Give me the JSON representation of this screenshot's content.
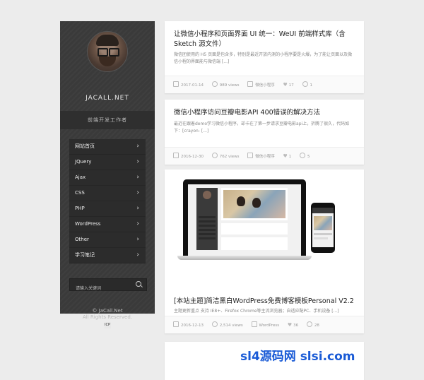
{
  "sidebar": {
    "site_name": "JACALL.NET",
    "tagline": "前端开发工作者",
    "nav": [
      {
        "label": "网站首页"
      },
      {
        "label": "JQuery"
      },
      {
        "label": "Ajax"
      },
      {
        "label": "CSS"
      },
      {
        "label": "PHP"
      },
      {
        "label": "WordPress"
      },
      {
        "label": "Other"
      },
      {
        "label": "学习笔记"
      }
    ],
    "search_placeholder": "请输入关键词",
    "footer_line1": "© JaCall.Net",
    "footer_line2": "All Rights Reserved.",
    "footer_badge": "ICP"
  },
  "posts": [
    {
      "title": "让微信小程序和页面界面 UI 统一：WeUI 前端样式库（含 Sketch 源文件）",
      "excerpt": "微信团使用的 H5 页面是包含多，特别是最近开放内测的小程序要是火爆，为了能让页面以及微信小程的界面能与微信端 [...]",
      "date": "2017-01-14",
      "views": "989 views",
      "category": "微信小程序",
      "likes": "17",
      "comments": "1"
    },
    {
      "title": "微信小程序访问豆瓣电影API 400错误的解决方法",
      "excerpt": "最近在跟着demo学习微信小程序，却卡在了第一步请求豆瓣电影api上，折腾了很久，代码如下：[crayon- [...]",
      "date": "2016-12-30",
      "views": "762 views",
      "category": "微信小程序",
      "likes": "1",
      "comments": "5"
    },
    {
      "title": "[本站主题]简洁黑白WordPress免费博客模板Personal V2.2",
      "excerpt": "主题更新重点 支持 IE8+、Firefox Chrome等主流浏览器；自适应配PC、手机设备 [...]",
      "date": "2016-12-13",
      "views": "2,514 views",
      "category": "WordPress",
      "likes": "36",
      "comments": "28"
    }
  ],
  "watermark": "sl4源码网  slsi.com"
}
